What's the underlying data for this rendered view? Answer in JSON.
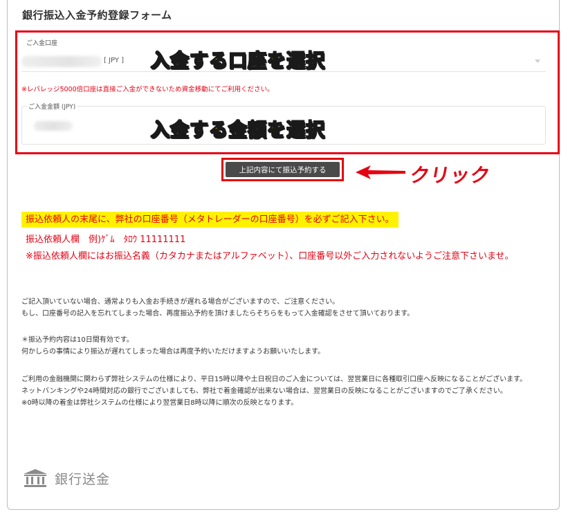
{
  "form": {
    "title": "銀行振込入金予約登録フォーム",
    "account_label": "ご入金口座",
    "account_currency": "[ JPY ]",
    "leverage_note": "※レバレッジ5000倍口座は直接ご入金ができないため資金移動にてご利用ください。",
    "amount_label": "ご入金金額 (JPY)",
    "submit_label": "上記内容にて振込予約する"
  },
  "annotations": {
    "select_account": "入金する口座を選択",
    "select_amount": "入金する金額を選択",
    "click": "クリック",
    "highlight_color": "#e50012",
    "callout_color": "#ffe100"
  },
  "notes": {
    "highlight": "振込依頼人の末尾に、弊社の口座番号（メタトレーダーの口座番号）を必ずご記入下さい。",
    "example": "振込依頼人欄　例)ｹﾞﾑ　ﾀﾛｳ 11111111",
    "warning": "※振込依頼人欄にはお振込名義（カタカナまたはアルファベット）、口座番号以外ご入力されないようご注意下さいませ。",
    "info_1_line_1": "ご記入頂いていない場合、通常よりも入金お手続きが遅れる場合がございますので、ご注意ください。",
    "info_1_line_2": "もし、口座番号の記入を忘れてしまった場合、再度振込予約を頂けましたらそちらをもって入金確認をさせて頂いております。",
    "info_2_line_1": "＊振込予約内容は10日間有効です。",
    "info_2_line_2": "何かしらの事情により振込が遅れてしまった場合は再度予約いただけますようお願いいたします。",
    "info_3_line_1": "ご利用の金融機関に関わらず弊社システムの仕様により、平日15時以降や土日祝日のご入金については、翌営業日に各種取引口座へ反映になることがございます。",
    "info_3_line_2": "ネットバンキングや24時間対応の銀行でございましても、弊社で着金確認が出来ない場合は、翌営業日の反映になることがございますのでご了承ください。",
    "info_3_line_3": "※0時以降の着金は弊社システムの仕様により翌営業日8時以降に順次の反映となります。"
  },
  "footer": {
    "bank_label": "銀行送金",
    "icon": "bank-building-icon"
  }
}
